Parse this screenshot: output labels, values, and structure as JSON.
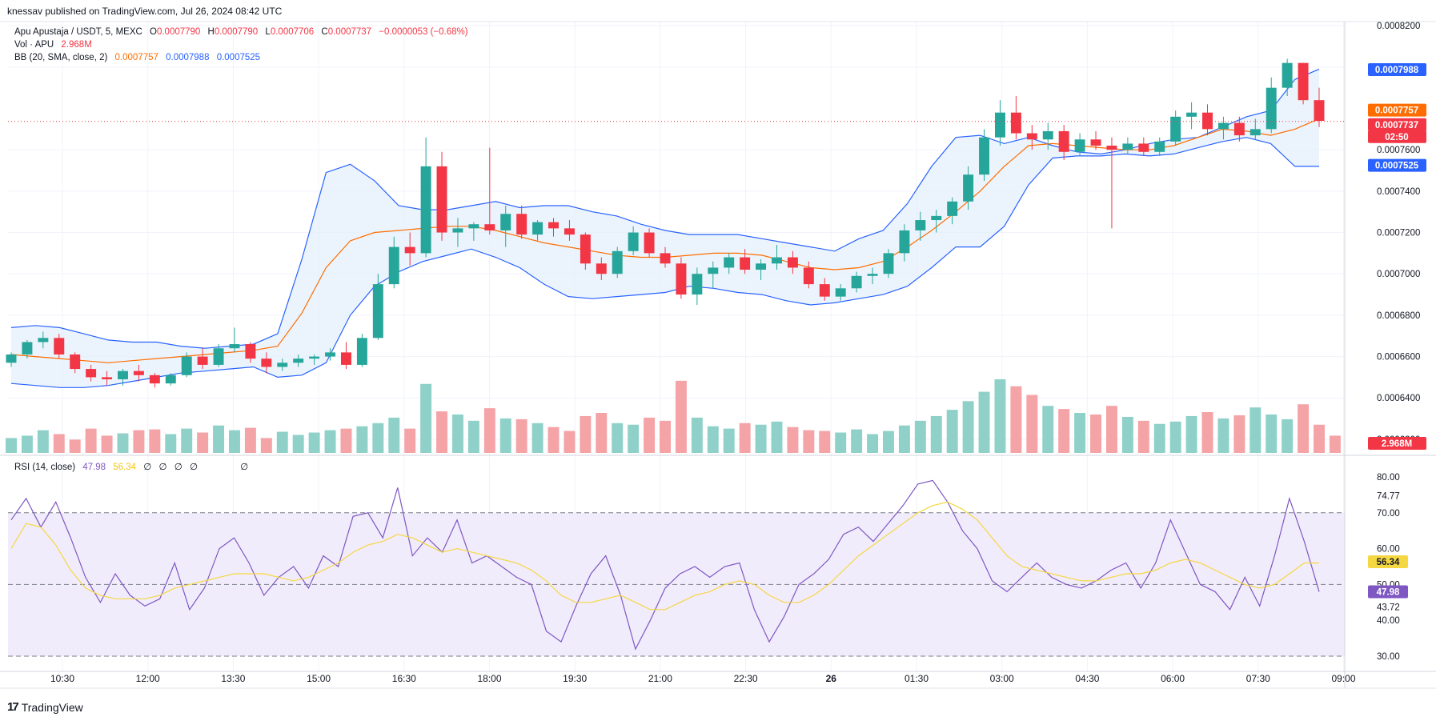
{
  "header": {
    "publisher_line": "knessav published on TradingView.com, Jul 26, 2024 08:42 UTC"
  },
  "legend": {
    "symbol": "Apu Apustaja / USDT, 5, MEXC",
    "o_label": "O",
    "o_value": "0.0007790",
    "h_label": "H",
    "h_value": "0.0007790",
    "l_label": "L",
    "l_value": "0.0007706",
    "c_label": "C",
    "c_value": "0.0007737",
    "change": "−0.0000053 (−0.68%)",
    "vol_label": "Vol · APU",
    "vol_value": "2.968M",
    "bb_label": "BB (20, SMA, close, 2)",
    "bb_basis": "0.0007757",
    "bb_upper": "0.0007988",
    "bb_lower": "0.0007525",
    "rsi_label": "RSI (14, close)",
    "rsi_value": "47.98",
    "rsi_ma": "56.34",
    "rsi_extra": [
      "∅",
      "∅",
      "∅",
      "∅",
      "∅"
    ]
  },
  "footer": {
    "logo_text": "TradingView",
    "logo_mark": "17"
  },
  "colors": {
    "up": "#26a69a",
    "down": "#f23645",
    "vol_up": "#8fd1c8",
    "vol_down": "#f4a3a6",
    "bb_band": "#2962ff",
    "bb_basis": "#ff6d00",
    "bb_fill": "#e3f0fb",
    "rsi_line": "#7e57c2",
    "rsi_ma": "#f5d742",
    "rsi_fill": "#f1ecfb",
    "price_line": "#f23645"
  },
  "chart_data": [
    {
      "type": "candlestick",
      "title": "Apu Apustaja / USDT, 5, MEXC",
      "x_ticks": [
        "10:30",
        "12:00",
        "13:30",
        "15:00",
        "16:30",
        "18:00",
        "19:30",
        "21:00",
        "22:30",
        "26",
        "01:30",
        "03:00",
        "04:30",
        "06:00",
        "07:30",
        "09:00"
      ],
      "y_ticks": [
        "0.0008200",
        "0.0008000",
        "0.0007600",
        "0.0007400",
        "0.0007200",
        "0.0007000",
        "0.0006800",
        "0.0006600",
        "0.0006400",
        "0.0006200"
      ],
      "ylim": [
        0.000613,
        0.000822
      ],
      "price_labels": [
        {
          "value": "0.0007988",
          "color": "#2962ff"
        },
        {
          "value": "0.0007757",
          "color": "#ff6d00"
        },
        {
          "value": "0.0007737",
          "color": "#f23645"
        },
        {
          "value": "02:50",
          "color": "#f23645"
        },
        {
          "value": "0.0007525",
          "color": "#2962ff"
        }
      ],
      "volume_label": {
        "value": "2.968M",
        "color": "#f23645"
      },
      "bb_upper": [
        0.000674,
        0.000675,
        0.000674,
        0.000671,
        0.000668,
        0.000667,
        0.000667,
        0.000665,
        0.000664,
        0.000665,
        0.000666,
        0.000671,
        0.000707,
        0.000749,
        0.000753,
        0.000745,
        0.000733,
        0.000731,
        0.000731,
        0.000733,
        0.000735,
        0.000732,
        0.000733,
        0.000733,
        0.00073,
        0.000728,
        0.000724,
        0.000721,
        0.000719,
        0.000719,
        0.000719,
        0.000717,
        0.000715,
        0.000713,
        0.000711,
        0.000717,
        0.000721,
        0.000734,
        0.000752,
        0.000766,
        0.000767,
        0.000763,
        0.000766,
        0.000762,
        0.000759,
        0.000758,
        0.00076,
        0.000763,
        0.000765,
        0.000766,
        0.000771,
        0.000776,
        0.000779,
        0.000794,
        0.000799
      ],
      "bb_basis": [
        0.000661,
        0.00066,
        0.000659,
        0.000658,
        0.000657,
        0.000658,
        0.000659,
        0.00066,
        0.000661,
        0.000662,
        0.000663,
        0.000665,
        0.000681,
        0.000703,
        0.000716,
        0.00072,
        0.000721,
        0.000722,
        0.000723,
        0.000723,
        0.000721,
        0.000718,
        0.000715,
        0.000713,
        0.000711,
        0.000709,
        0.000708,
        0.000708,
        0.000709,
        0.00071,
        0.00071,
        0.000709,
        0.000706,
        0.000703,
        0.000702,
        0.000703,
        0.000706,
        0.000713,
        0.000721,
        0.00073,
        0.00074,
        0.000752,
        0.000762,
        0.000763,
        0.000762,
        0.000761,
        0.00076,
        0.00076,
        0.000762,
        0.000766,
        0.00077,
        0.000769,
        0.000767,
        0.00077,
        0.000775
      ],
      "bb_lower": [
        0.000647,
        0.000646,
        0.000645,
        0.000645,
        0.000646,
        0.000648,
        0.00065,
        0.000652,
        0.000653,
        0.000654,
        0.000655,
        0.00065,
        0.000651,
        0.000657,
        0.00068,
        0.000694,
        0.000701,
        0.000706,
        0.000709,
        0.000712,
        0.000708,
        0.000703,
        0.000695,
        0.000689,
        0.000688,
        0.000689,
        0.00069,
        0.000691,
        0.000694,
        0.000693,
        0.000691,
        0.00069,
        0.000687,
        0.000685,
        0.000686,
        0.000688,
        0.00069,
        0.000694,
        0.000703,
        0.000713,
        0.000713,
        0.000723,
        0.000743,
        0.000756,
        0.000757,
        0.000757,
        0.000758,
        0.000757,
        0.000758,
        0.000761,
        0.000764,
        0.000766,
        0.000763,
        0.000752,
        0.000752
      ],
      "ohlc": [
        [
          0.000657,
          0.000662,
          0.000655,
          0.000661
        ],
        [
          0.000661,
          0.000668,
          0.000659,
          0.000667
        ],
        [
          0.000667,
          0.000672,
          0.000664,
          0.000669
        ],
        [
          0.000669,
          0.000671,
          0.000659,
          0.000661
        ],
        [
          0.000661,
          0.000662,
          0.000652,
          0.000654
        ],
        [
          0.000654,
          0.000656,
          0.000648,
          0.00065
        ],
        [
          0.00065,
          0.000653,
          0.000646,
          0.000649
        ],
        [
          0.000649,
          0.000654,
          0.000646,
          0.000653
        ],
        [
          0.000653,
          0.000656,
          0.000648,
          0.000651
        ],
        [
          0.000651,
          0.000652,
          0.000645,
          0.000647
        ],
        [
          0.000647,
          0.000652,
          0.000646,
          0.000651
        ],
        [
          0.000651,
          0.000662,
          0.00065,
          0.00066
        ],
        [
          0.00066,
          0.000664,
          0.000654,
          0.000656
        ],
        [
          0.000656,
          0.000666,
          0.000655,
          0.000664
        ],
        [
          0.000664,
          0.000674,
          0.000662,
          0.000666
        ],
        [
          0.000666,
          0.000667,
          0.000657,
          0.000659
        ],
        [
          0.000659,
          0.000662,
          0.000652,
          0.000655
        ],
        [
          0.000655,
          0.000659,
          0.000653,
          0.000657
        ],
        [
          0.000657,
          0.000661,
          0.000655,
          0.000659
        ],
        [
          0.000659,
          0.000661,
          0.000656,
          0.00066
        ],
        [
          0.00066,
          0.000664,
          0.000658,
          0.000662
        ],
        [
          0.000662,
          0.000667,
          0.000654,
          0.000656
        ],
        [
          0.000656,
          0.000671,
          0.000655,
          0.000669
        ],
        [
          0.000669,
          0.0007,
          0.000668,
          0.000695
        ],
        [
          0.000695,
          0.000718,
          0.000693,
          0.000713
        ],
        [
          0.000713,
          0.00072,
          0.000704,
          0.00071
        ],
        [
          0.00071,
          0.000766,
          0.000708,
          0.000752
        ],
        [
          0.000752,
          0.000759,
          0.000716,
          0.00072
        ],
        [
          0.00072,
          0.000727,
          0.000713,
          0.000722
        ],
        [
          0.000722,
          0.000725,
          0.000716,
          0.000724
        ],
        [
          0.000724,
          0.000761,
          0.000719,
          0.000721
        ],
        [
          0.000721,
          0.000733,
          0.000713,
          0.000729
        ],
        [
          0.000729,
          0.000733,
          0.000717,
          0.000719
        ],
        [
          0.000719,
          0.000726,
          0.000716,
          0.000725
        ],
        [
          0.000725,
          0.000727,
          0.000718,
          0.000722
        ],
        [
          0.000722,
          0.000726,
          0.000716,
          0.000719
        ],
        [
          0.000719,
          0.00072,
          0.000702,
          0.000705
        ],
        [
          0.000705,
          0.000708,
          0.000697,
          0.0007
        ],
        [
          0.0007,
          0.000713,
          0.000698,
          0.000711
        ],
        [
          0.000711,
          0.000723,
          0.000709,
          0.00072
        ],
        [
          0.00072,
          0.000722,
          0.000708,
          0.00071
        ],
        [
          0.00071,
          0.000713,
          0.000703,
          0.000705
        ],
        [
          0.000705,
          0.000708,
          0.000688,
          0.00069
        ],
        [
          0.00069,
          0.000703,
          0.000685,
          0.0007
        ],
        [
          0.0007,
          0.000706,
          0.000693,
          0.000703
        ],
        [
          0.000703,
          0.00071,
          0.0007,
          0.000708
        ],
        [
          0.000708,
          0.000712,
          0.0007,
          0.000702
        ],
        [
          0.000702,
          0.000707,
          0.000697,
          0.000705
        ],
        [
          0.000705,
          0.000714,
          0.000702,
          0.000708
        ],
        [
          0.000708,
          0.000711,
          0.0007,
          0.000703
        ],
        [
          0.000703,
          0.000706,
          0.000693,
          0.000695
        ],
        [
          0.000695,
          0.000698,
          0.000687,
          0.000689
        ],
        [
          0.000689,
          0.000695,
          0.000687,
          0.000693
        ],
        [
          0.000693,
          0.000701,
          0.000691,
          0.000699
        ],
        [
          0.000699,
          0.000703,
          0.000695,
          0.0007
        ],
        [
          0.0007,
          0.000712,
          0.000698,
          0.00071
        ],
        [
          0.00071,
          0.000724,
          0.000706,
          0.000721
        ],
        [
          0.000721,
          0.00073,
          0.000716,
          0.000726
        ],
        [
          0.000726,
          0.000731,
          0.00072,
          0.000728
        ],
        [
          0.000728,
          0.000737,
          0.000724,
          0.000735
        ],
        [
          0.000735,
          0.000752,
          0.000731,
          0.000748
        ],
        [
          0.000748,
          0.00077,
          0.000745,
          0.000766
        ],
        [
          0.000766,
          0.000784,
          0.000762,
          0.000778
        ],
        [
          0.000778,
          0.000786,
          0.000765,
          0.000768
        ],
        [
          0.000768,
          0.000772,
          0.00076,
          0.000765
        ],
        [
          0.000765,
          0.000773,
          0.00076,
          0.000769
        ],
        [
          0.000769,
          0.000772,
          0.000755,
          0.000759
        ],
        [
          0.000759,
          0.000768,
          0.000757,
          0.000765
        ],
        [
          0.000765,
          0.000769,
          0.00076,
          0.000762
        ],
        [
          0.000762,
          0.000766,
          0.000722,
          0.00076
        ],
        [
          0.00076,
          0.000766,
          0.000758,
          0.000763
        ],
        [
          0.000763,
          0.000766,
          0.000757,
          0.000759
        ],
        [
          0.000759,
          0.000766,
          0.000757,
          0.000764
        ],
        [
          0.000764,
          0.000779,
          0.000762,
          0.000776
        ],
        [
          0.000776,
          0.000783,
          0.00077,
          0.000778
        ],
        [
          0.000778,
          0.000782,
          0.000767,
          0.00077
        ],
        [
          0.00077,
          0.000776,
          0.000765,
          0.000773
        ],
        [
          0.000773,
          0.000776,
          0.000764,
          0.000767
        ],
        [
          0.000767,
          0.000775,
          0.000765,
          0.00077
        ],
        [
          0.00077,
          0.000795,
          0.000768,
          0.00079
        ],
        [
          0.00079,
          0.000804,
          0.000786,
          0.000802
        ],
        [
          0.000802,
          0.000802,
          0.000782,
          0.000784
        ],
        [
          0.000784,
          0.00079,
          0.000771,
          0.000774
        ]
      ],
      "volume": [
        0.19,
        0.22,
        0.29,
        0.24,
        0.17,
        0.31,
        0.22,
        0.25,
        0.29,
        0.3,
        0.24,
        0.31,
        0.26,
        0.35,
        0.29,
        0.32,
        0.19,
        0.27,
        0.23,
        0.26,
        0.29,
        0.31,
        0.34,
        0.38,
        0.45,
        0.31,
        0.88,
        0.53,
        0.49,
        0.41,
        0.57,
        0.44,
        0.43,
        0.38,
        0.33,
        0.28,
        0.47,
        0.51,
        0.38,
        0.36,
        0.45,
        0.41,
        0.92,
        0.45,
        0.34,
        0.31,
        0.38,
        0.36,
        0.4,
        0.33,
        0.29,
        0.28,
        0.26,
        0.3,
        0.24,
        0.28,
        0.35,
        0.41,
        0.47,
        0.55,
        0.66,
        0.78,
        0.94,
        0.85,
        0.74,
        0.6,
        0.56,
        0.51,
        0.49,
        0.6,
        0.46,
        0.41,
        0.37,
        0.4,
        0.47,
        0.52,
        0.44,
        0.48,
        0.58,
        0.49,
        0.43,
        0.62,
        0.36,
        0.22
      ],
      "current_price": 0.0007737
    },
    {
      "type": "line",
      "title": "RSI (14, close)",
      "y_ticks": [
        "80.00",
        "74.77",
        "70.00",
        "60.00",
        "56.34",
        "50.00",
        "47.98",
        "43.72",
        "40.00",
        "30.00"
      ],
      "ylim": [
        28,
        82
      ],
      "bands": [
        70,
        50,
        30
      ],
      "series": [
        {
          "name": "RSI",
          "values": [
            68,
            74,
            66,
            73,
            63,
            52,
            45,
            53,
            47,
            44,
            46,
            56,
            43,
            49,
            60,
            63,
            56,
            47,
            52,
            55,
            49,
            58,
            55,
            69,
            70,
            63,
            77,
            58,
            63,
            59,
            68,
            56,
            58,
            55,
            52,
            50,
            37,
            34,
            44,
            53,
            58,
            47,
            32,
            40,
            49,
            53,
            55,
            52,
            55,
            56,
            43,
            34,
            41,
            50,
            53,
            57,
            64,
            66,
            62,
            67,
            72,
            78,
            79,
            73,
            65,
            60,
            51,
            48,
            52,
            56,
            52,
            50,
            49,
            51,
            54,
            56,
            49,
            56,
            68,
            59,
            50,
            48,
            43,
            52,
            44,
            58,
            74,
            62,
            48
          ]
        },
        {
          "name": "RSI-based MA",
          "values": [
            60,
            67,
            66,
            61,
            54,
            49,
            47,
            46,
            46,
            46,
            47,
            49,
            50,
            51,
            52,
            53,
            53,
            53,
            52,
            51,
            52,
            54,
            56,
            59,
            61,
            62,
            64,
            63,
            61,
            59,
            60,
            59,
            58,
            57,
            56,
            54,
            51,
            47,
            45,
            45,
            46,
            47,
            45,
            43,
            43,
            45,
            47,
            48,
            50,
            51,
            50,
            47,
            45,
            45,
            47,
            50,
            54,
            58,
            61,
            64,
            67,
            70,
            72,
            73,
            71,
            68,
            63,
            58,
            55,
            54,
            53,
            52,
            51,
            51,
            52,
            53,
            53,
            54,
            56,
            57,
            56,
            54,
            52,
            50,
            49,
            50,
            53,
            56,
            56
          ]
        }
      ]
    }
  ]
}
